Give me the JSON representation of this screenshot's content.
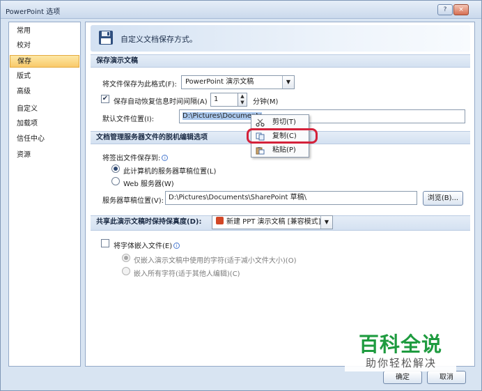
{
  "window": {
    "title": "PowerPoint 选项"
  },
  "titlebar": {
    "help_label": "?",
    "close_label": "×"
  },
  "sidebar": {
    "items": [
      {
        "label": "常用"
      },
      {
        "label": "校对"
      },
      {
        "label": "保存",
        "active": true
      },
      {
        "label": "版式"
      },
      {
        "label": "高级"
      },
      {
        "label": "自定义"
      },
      {
        "label": "加载项"
      },
      {
        "label": "信任中心"
      },
      {
        "label": "资源"
      }
    ]
  },
  "banner": {
    "icon": "floppy-disk-icon",
    "text": "自定义文档保存方式。"
  },
  "sections": {
    "save_presentations": {
      "heading": "保存演示文稿",
      "format_label": "将文件保存为此格式(F):",
      "format_value": "PowerPoint 演示文稿",
      "autorecover_label": "保存自动恢复信息时间间隔(A)",
      "autorecover_checked": true,
      "autorecover_value": "1",
      "minutes_label": "分钟(M)",
      "default_location_label": "默认文件位置(I):",
      "default_location_value": "D:\\Pictures\\Documents"
    },
    "offline_editing": {
      "heading": "文档管理服务器文件的脱机编辑选项",
      "checkout_label": "将签出文件保存到:",
      "option_local": "此计算机的服务器草稿位置(L)",
      "option_web": "Web 服务器(W)",
      "drafts_location_label": "服务器草稿位置(V):",
      "drafts_location_value": "D:\\Pictures\\Documents\\SharePoint 草稿\\",
      "browse_label": "浏览(B)..."
    },
    "fidelity": {
      "heading": "共享此演示文稿时保持保真度(D):",
      "doc_value": "新建 PPT 演示文稿 [兼容模式]",
      "embed_fonts_label": "将字体嵌入文件(E)",
      "embed_used_only": "仅嵌入演示文稿中使用的字符(适于减小文件大小)(O)",
      "embed_all": "嵌入所有字符(适于其他人编辑)(C)"
    }
  },
  "context_menu": {
    "items": [
      {
        "label": "剪切(T)",
        "icon": "scissors-icon"
      },
      {
        "label": "复制(C)",
        "icon": "copy-icon"
      },
      {
        "label": "粘贴(P)",
        "icon": "paste-icon"
      }
    ]
  },
  "footer": {
    "ok_label": "确定",
    "cancel_label": "取消"
  },
  "watermark": {
    "title": "百科全说",
    "subtitle": "助你轻松解决"
  },
  "colors": {
    "highlight_ring": "#d4213a",
    "active_item": "#f9c96a",
    "watermark_green": "#1e9b3f"
  }
}
